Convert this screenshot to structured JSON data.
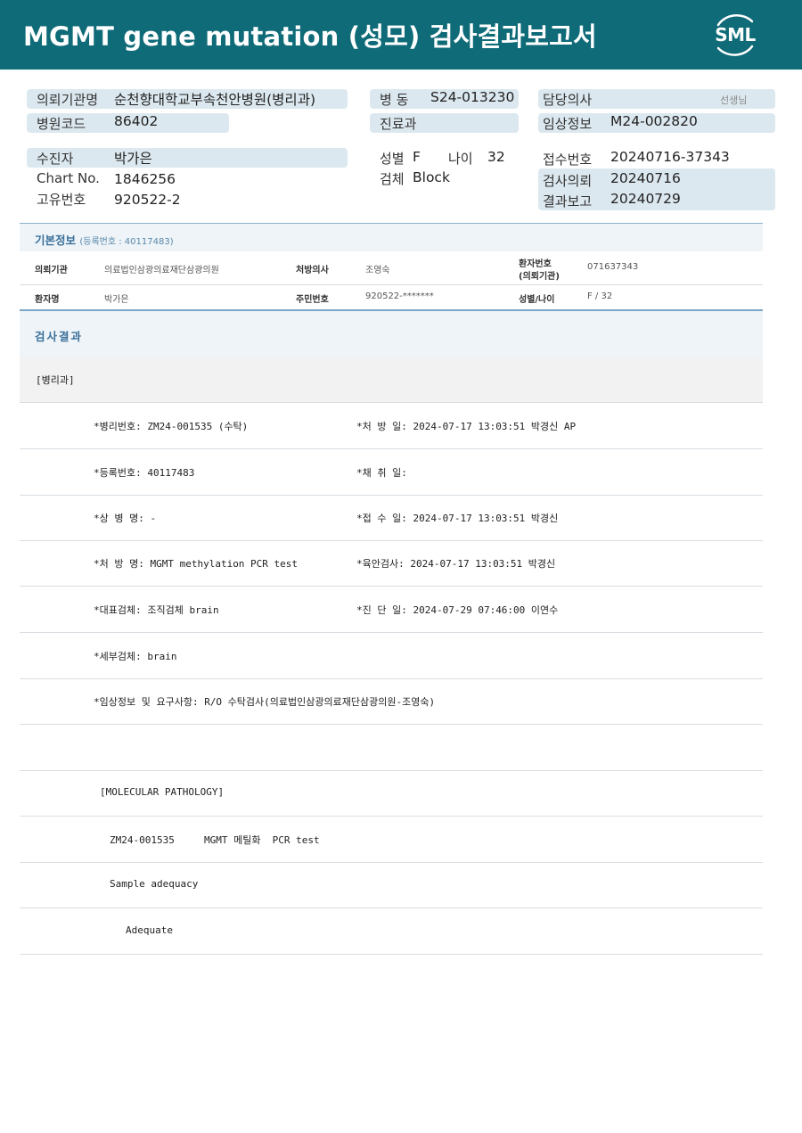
{
  "header": {
    "title": "MGMT gene mutation (성모) 검사결과보고서",
    "logo_text": "SML",
    "bg_color": "#0f6b78"
  },
  "info": {
    "institution_label": "의뢰기관명",
    "institution_value": "순천향대학교부속천안병원(병리과)",
    "hospital_code_label": "병원코드",
    "hospital_code_value": "86402",
    "ward_label": "병  동",
    "ward_value": "S24-013230",
    "dept_label": "진료과",
    "dept_value": "",
    "doctor_label": "담당의사",
    "doctor_value": "",
    "doctor_suffix": "선생님",
    "clinical_label": "임상정보",
    "clinical_value": "M24-002820",
    "patient_label": "수진자",
    "patient_value": "박가은",
    "chart_label": "Chart No.",
    "chart_value": "1846256",
    "unique_label": "고유번호",
    "unique_value": "920522-2",
    "sex_label": "성별",
    "sex_value": "F",
    "age_label": "나이",
    "age_value": "32",
    "specimen_label": "검체",
    "specimen_value": "Block",
    "receipt_label": "접수번호",
    "receipt_value": "20240716-37343",
    "request_label": "검사의뢰",
    "request_value": "20240716",
    "report_label": "결과보고",
    "report_value": "20240729"
  },
  "basic": {
    "title": "기본정보",
    "reg_no": "(등록번호 : 40117483)",
    "row1": {
      "k1": "의뢰기관",
      "v1": "의료법인삼광의료재단삼광의원",
      "k2": "처방의사",
      "v2": "조영숙",
      "k3_line1": "환자번호",
      "k3_line2": "(의뢰기관)",
      "v3": "071637343"
    },
    "row2": {
      "k1": "환자명",
      "v1": "박가은",
      "k2": "주민번호",
      "v2": "920522-*******",
      "k3": "성별/나이",
      "v3": "F / 32"
    }
  },
  "result": {
    "title": "검사결과",
    "dept": "[병리과]",
    "rows": [
      {
        "left": "*병리번호: ZM24-001535 (수탁)",
        "right": "*처 방 일: 2024-07-17 13:03:51  박경신 AP"
      },
      {
        "left": "*등록번호: 40117483",
        "right": "*채 취 일:"
      },
      {
        "left": "*상 병 명: -",
        "right": "*접 수 일: 2024-07-17 13:03:51  박경신"
      },
      {
        "left": "*처 방 명: MGMT methylation  PCR test",
        "right": "*육안검사: 2024-07-17 13:03:51  박경신"
      },
      {
        "left": "*대표검체: 조직검체 brain",
        "right": "*진 단 일: 2024-07-29 07:46:00  이연수"
      },
      {
        "left": "*세부검체: brain",
        "right": ""
      },
      {
        "left": "*임상정보 및 요구사항: R/O 수탁검사(의료법인삼광의료재단삼광의원-조영숙)",
        "right": ""
      },
      {
        "left": "",
        "right": ""
      }
    ],
    "molecular": "[MOLECULAR PATHOLOGY]",
    "test_line": "ZM24-001535     MGMT 메틸화  PCR test",
    "adequacy_label": "Sample adequacy",
    "adequacy_value": "Adequate"
  }
}
